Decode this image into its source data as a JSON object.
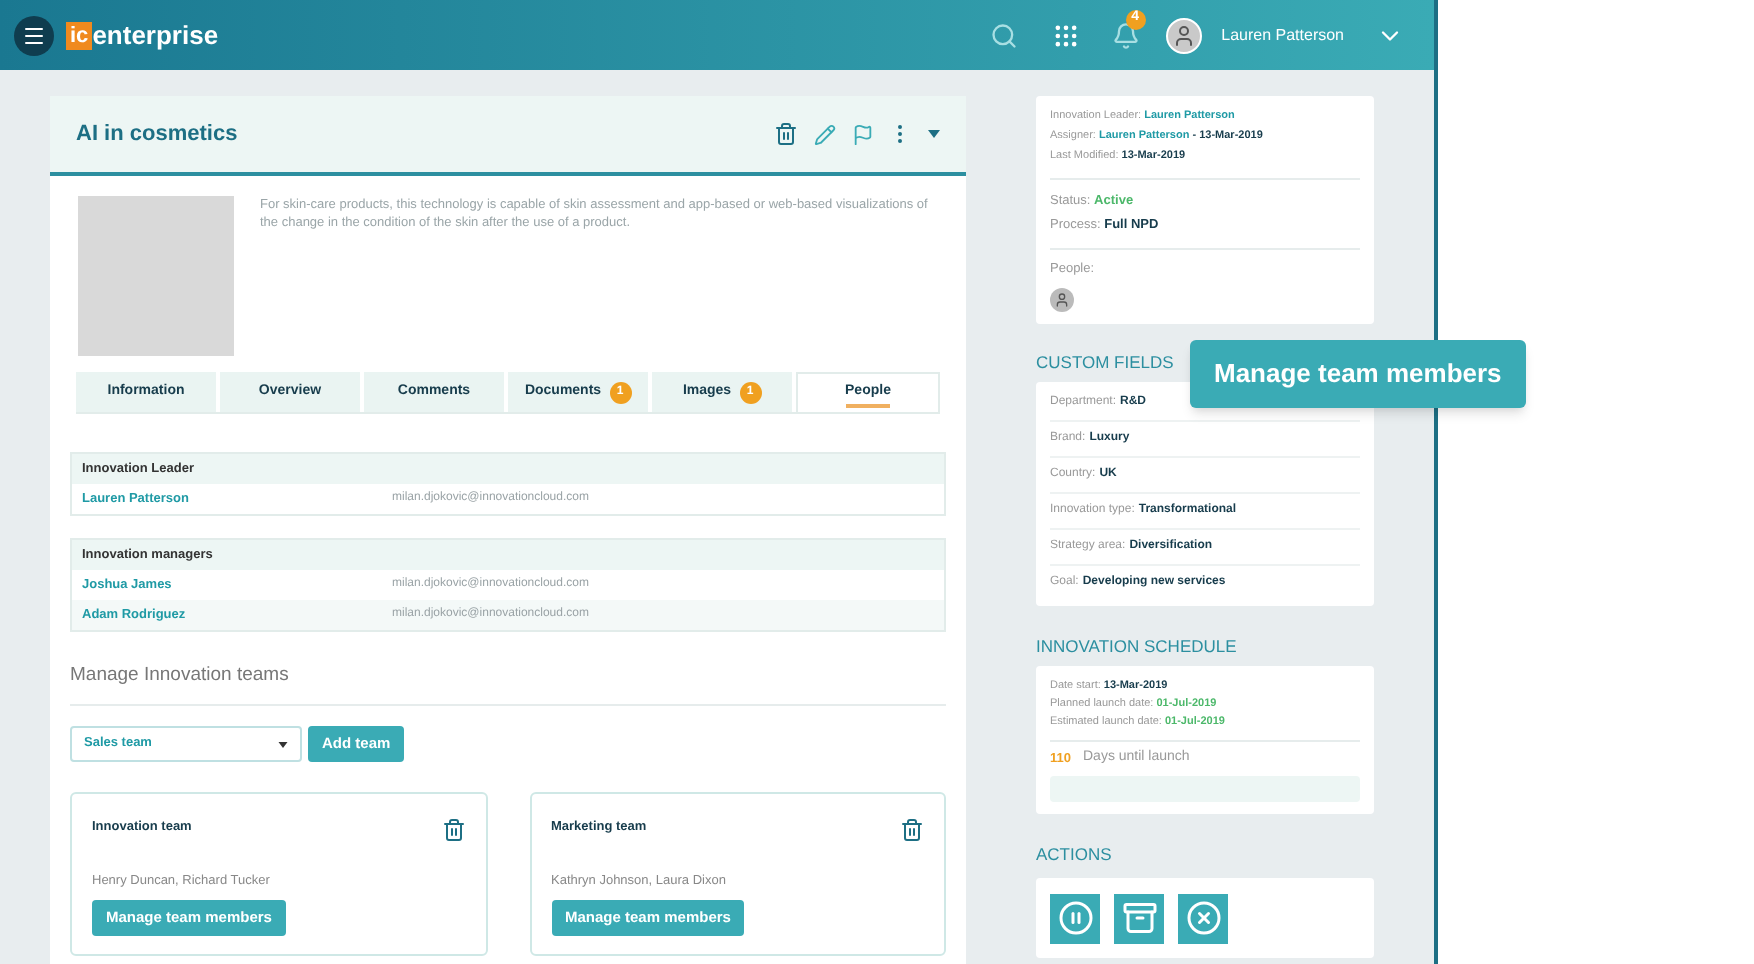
{
  "header": {
    "logo_badge": "ic",
    "logo_text": "enterprise",
    "notification_count": "4",
    "user_name": "Lauren Patterson"
  },
  "project": {
    "title": "AI in cosmetics",
    "description": "For skin-care products, this technology is capable of skin assessment and app-based or web-based visualizations of the change in the condition of the skin after the use of a product.",
    "tabs": [
      {
        "label": "Information",
        "selected": false
      },
      {
        "label": "Overview",
        "selected": false
      },
      {
        "label": "Comments",
        "selected": false
      },
      {
        "label": "Documents",
        "badge": "1",
        "selected": false
      },
      {
        "label": "Images",
        "badge": "1",
        "selected": false
      },
      {
        "label": "People",
        "selected": true
      }
    ],
    "people_tables": [
      {
        "heading": "Innovation Leader",
        "rows": [
          {
            "name": "Lauren Patterson",
            "email": "milan.djokovic@innovationcloud.com"
          }
        ]
      },
      {
        "heading": "Innovation managers",
        "rows": [
          {
            "name": "Joshua James",
            "email": "milan.djokovic@innovationcloud.com"
          },
          {
            "name": "Adam Rodriguez",
            "email": "milan.djokovic@innovationcloud.com"
          }
        ]
      }
    ],
    "teams_section": {
      "title": "Manage Innovation teams",
      "select_value": "Sales team",
      "add_button": "Add team",
      "teams": [
        {
          "name": "Innovation team",
          "members": "Henry Duncan, Richard Tucker",
          "button": "Manage team members"
        },
        {
          "name": "Marketing team",
          "members": "Kathryn Johnson, Laura Dixon",
          "button": "Manage team members"
        }
      ]
    }
  },
  "sidebar": {
    "summary_groups": [
      [
        {
          "label": "Innovation Leader:",
          "parts": [
            {
              "text": "Lauren Patterson",
              "kind": "link"
            }
          ]
        },
        {
          "label": "Assigner:",
          "parts": [
            {
              "text": "Lauren Patterson",
              "kind": "link"
            },
            {
              "text": " - 13-Mar-2019",
              "kind": "strong"
            }
          ]
        },
        {
          "label": "Last Modified:",
          "parts": [
            {
              "text": "13-Mar-2019",
              "kind": "strong"
            }
          ]
        }
      ],
      [
        {
          "label": "Status:",
          "parts": [
            {
              "text": "Active",
              "kind": "status"
            }
          ]
        },
        {
          "label": "Process:",
          "parts": [
            {
              "text": "Full NPD",
              "kind": "strong"
            }
          ]
        }
      ]
    ],
    "people_label": "People:",
    "custom_fields": {
      "title": "CUSTOM FIELDS",
      "rows": [
        {
          "label": "Department:",
          "value": "R&D"
        },
        {
          "label": "Brand:",
          "value": "Luxury"
        },
        {
          "label": "Country:",
          "value": "UK"
        },
        {
          "label": "Innovation type:",
          "value": "Transformational"
        },
        {
          "label": "Strategy area:",
          "value": "Diversification"
        },
        {
          "label": "Goal:",
          "value": "Developing new services"
        }
      ]
    },
    "schedule": {
      "title": "INNOVATION SCHEDULE",
      "rows": [
        {
          "label": "Date start:",
          "value": "13-Mar-2019",
          "kind": "strong"
        },
        {
          "label": "Planned launch date:",
          "value": "01-Jul-2019",
          "kind": "status"
        },
        {
          "label": "Estimated launch date:",
          "value": "01-Jul-2019",
          "kind": "status"
        }
      ],
      "days_count": "110",
      "days_label": "Days until launch"
    },
    "actions": {
      "title": "ACTIONS",
      "buttons": [
        {
          "kind": "pause"
        },
        {
          "kind": "archive"
        },
        {
          "kind": "reject"
        }
      ]
    }
  },
  "tooltip": "Manage team members"
}
